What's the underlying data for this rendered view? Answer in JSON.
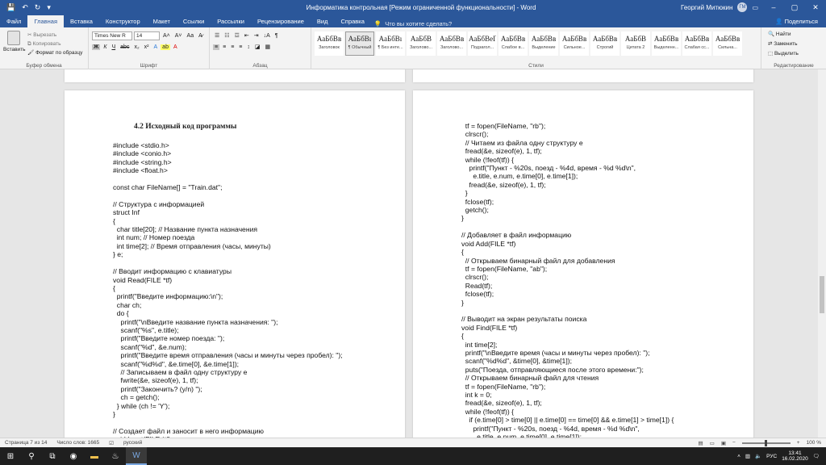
{
  "window": {
    "title": "Информатика контрольная [Режим ограниченной функциональности] - Word",
    "user": "Георгий Митюкин",
    "user_initials": "ГМ"
  },
  "qat": {
    "save": "💾",
    "undo": "↶",
    "redo": "↻",
    "more": "▾"
  },
  "tabs": [
    "Файл",
    "Главная",
    "Вставка",
    "Конструктор",
    "Макет",
    "Ссылки",
    "Рассылки",
    "Рецензирование",
    "Вид",
    "Справка"
  ],
  "tell_me": "Что вы хотите сделать?",
  "share": "Поделиться",
  "clipboard": {
    "paste": "Вставить",
    "cut": "Вырезать",
    "copy": "Копировать",
    "format_painter": "Формат по образцу",
    "group": "Буфер обмена"
  },
  "font": {
    "name": "Times New R",
    "size": "14",
    "group": "Шрифт"
  },
  "paragraph": {
    "group": "Абзац"
  },
  "styles": {
    "group": "Стили",
    "items": [
      {
        "preview": "АаБбВв",
        "name": "Заголовок"
      },
      {
        "preview": "АаБбВı",
        "name": "¶ Обычный"
      },
      {
        "preview": "АаБбВı",
        "name": "¶ Без инте..."
      },
      {
        "preview": "АаБбВ",
        "name": "Заголово..."
      },
      {
        "preview": "АаБбВв",
        "name": "Заголово..."
      },
      {
        "preview": "АаБбВеГ",
        "name": "Подзагол..."
      },
      {
        "preview": "АаБбВв",
        "name": "Слабое в..."
      },
      {
        "preview": "АаБбВв",
        "name": "Выделение"
      },
      {
        "preview": "АаБбВв",
        "name": "Сильное..."
      },
      {
        "preview": "АаБбВв",
        "name": "Строгий"
      },
      {
        "preview": "АаБбВ",
        "name": "Цитата 2"
      },
      {
        "preview": "АаБбВв",
        "name": "Выделенн..."
      },
      {
        "preview": "АаБбВв",
        "name": "Слабая сс..."
      },
      {
        "preview": "АаБбВв",
        "name": "Сильна..."
      }
    ]
  },
  "editing": {
    "find": "Найти",
    "replace": "Заменить",
    "select": "Выделить",
    "group": "Редактирование"
  },
  "doc": {
    "heading": "4.2 Исходный код программы",
    "left_code": "#include <stdio.h>\n#include <conio.h>\n#include <string.h>\n#include <float.h>\n\nconst char FileName[] = \"Train.dat\";\n\n// Структура с информацией\nstruct Inf\n{\n  char title[20]; // Название пункта назначения\n  int num; // Номер поезда\n  int time[2]; // Время отправления (часы, минуты)\n} e;\n\n// Вводит информацию с клавиатуры\nvoid Read(FILE *tf)\n{\n  printf(\"Введите информацию:\\n\");\n  char ch;\n  do {\n    printf(\"\\nВведите название пункта назначения: \");\n    scanf(\"%s\", e.title);\n    printf(\"Введите номер поезда: \");\n    scanf(\"%d\", &e.num);\n    printf(\"Введите время отправления (часы и минуты через пробел): \");\n    scanf(\"%d%d\", &e.time[0], &e.time[1]);\n    // Записываем в файл одну структуру е\n    fwrite(&e, sizeof(e), 1, tf);\n    printf(\"Закончить? (y/n) \");\n    ch = getch();\n  } while (ch != 'Y');\n}\n\n// Создает файл и заносит в него информацию\nvoid Input(FILE *tf)",
    "right_code": "  tf = fopen(FileName, \"rb\");\n  clrscr();\n  // Читаем из файла одну структуру е\n  fread(&e, sizeof(e), 1, tf);\n  while (!feof(tf)) {\n    printf(\"Пункт - %20s, поезд - %4d, время - %d %d\\n\",\n      e.title, e.num, e.time[0], e.time[1]);\n    fread(&e, sizeof(e), 1, tf);\n  }\n  fclose(tf);\n  getch();\n}\n\n// Добавляет в файл информацию\nvoid Add(FILE *tf)\n{\n  // Открываем бинарный файл для добавления\n  tf = fopen(FileName, \"ab\");\n  clrscr();\n  Read(tf);\n  fclose(tf);\n}\n\n// Выводит на экран результаты поиска\nvoid Find(FILE *tf)\n{\n  int time[2];\n  printf(\"\\nВведите время (часы и минуты через пробел): \");\n  scanf(\"%d%d\", &time[0], &time[1]);\n  puts(\"Поезда, отправляющиеся после этого времени:\");\n  // Открываем бинарный файл для чтения\n  tf = fopen(FileName, \"rb\");\n  int k = 0;\n  fread(&e, sizeof(e), 1, tf);\n  while (!feof(tf)) {\n    if (e.time[0] > time[0] || e.time[0] == time[0] && e.time[1] > time[1]) {\n      printf(\"Пункт - %20s, поезд - %4d, время - %d %d\\n\",\n        e.title, e.num, e.time[0], e.time[1]);"
  },
  "status": {
    "page": "Страница 7 из 14",
    "words": "Число слов: 1665",
    "lang": "русский",
    "zoom": "100 %"
  },
  "taskbar": {
    "lang": "РУС",
    "time": "13:41",
    "date": "16.02.2020"
  }
}
